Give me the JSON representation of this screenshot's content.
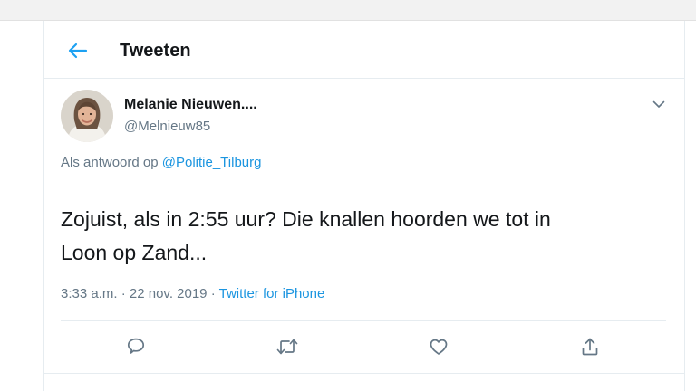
{
  "header": {
    "title": "Tweeten",
    "back_icon": "arrow-left-icon"
  },
  "tweet": {
    "author": {
      "name": "Melanie Nieuwen....",
      "handle": "@Melnieuw85",
      "avatar_icon": "profile-photo"
    },
    "reply_prefix": "Als antwoord op",
    "reply_to": "@Politie_Tilburg",
    "text": "Zojuist, als in 2:55 uur? Die knallen hoorden we tot in\nLoon op Zand...",
    "time": "3:33 a.m.",
    "separator": "·",
    "date": "22 nov. 2019",
    "source": "Twitter for iPhone",
    "menu_icon": "chevron-down-icon"
  },
  "actions": [
    {
      "icon": "reply-icon",
      "label": "Reply"
    },
    {
      "icon": "retweet-icon",
      "label": "Retweet"
    },
    {
      "icon": "like-icon",
      "label": "Like"
    },
    {
      "icon": "share-icon",
      "label": "Share"
    }
  ],
  "colors": {
    "accent": "#1da1f2",
    "link": "#1b95e0",
    "muted": "#657786",
    "text": "#14171a",
    "border": "#e6ecf0"
  }
}
